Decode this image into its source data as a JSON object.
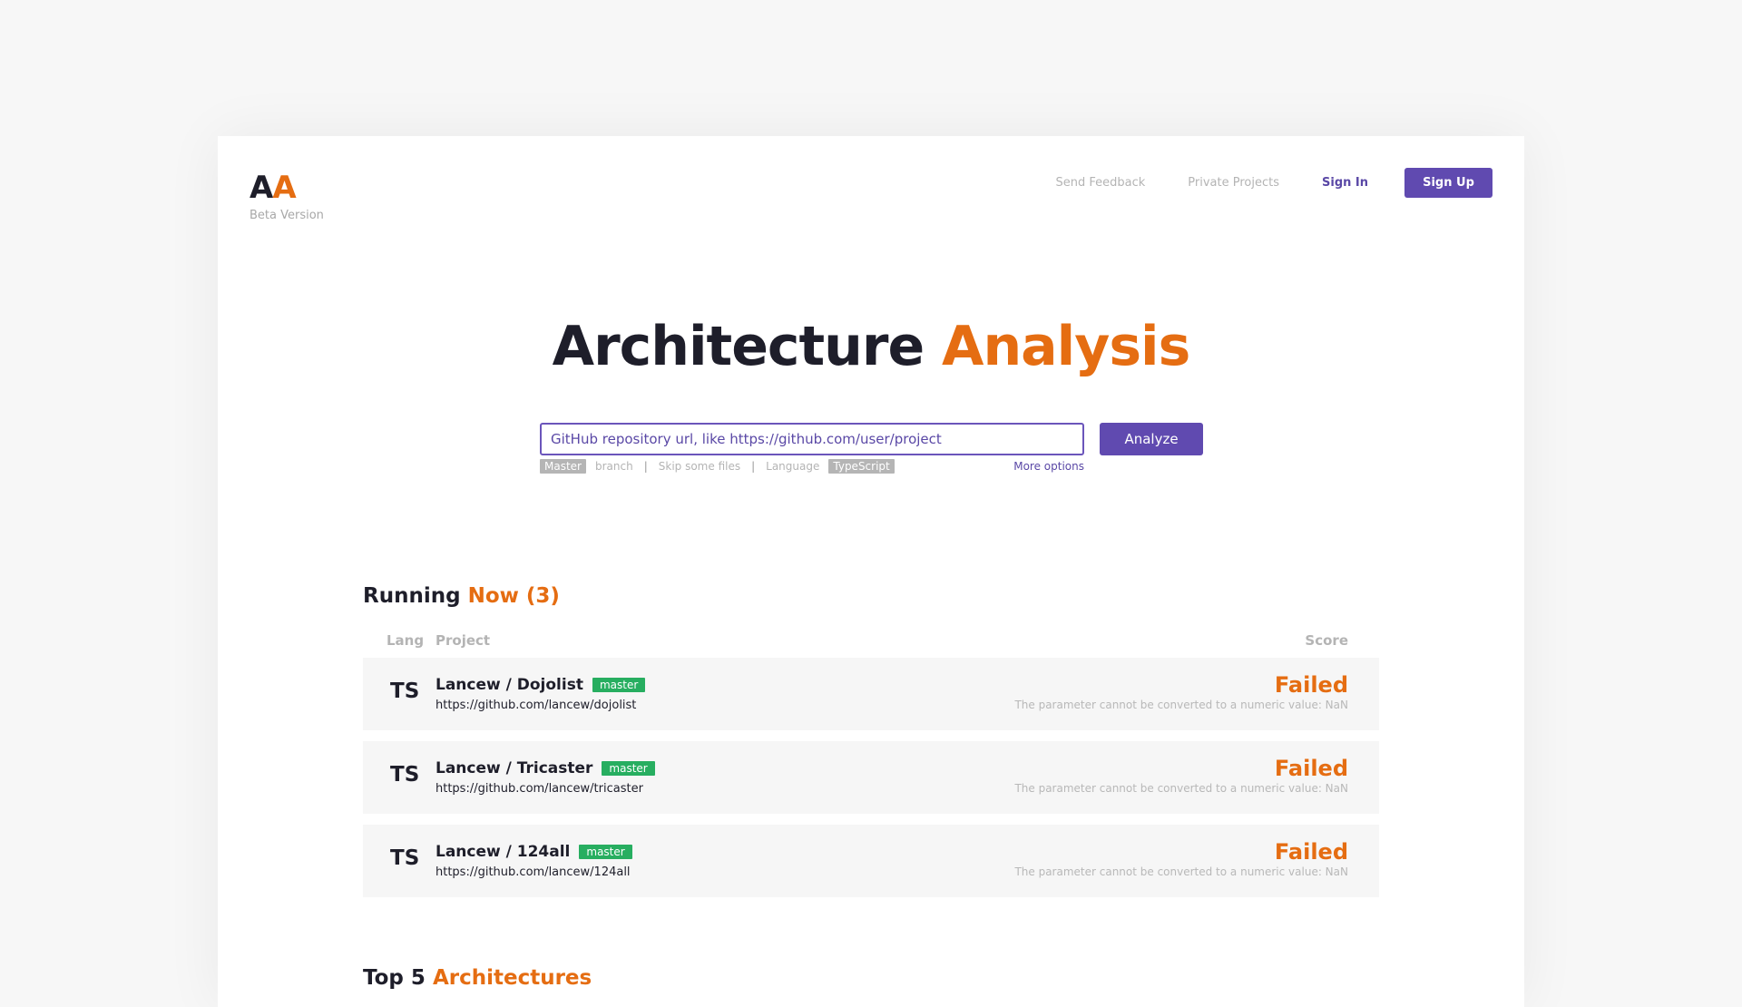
{
  "header": {
    "logo_left": "A",
    "logo_right": "A",
    "beta": "Beta Version",
    "nav": {
      "feedback": "Send Feedback",
      "private": "Private Projects",
      "signin": "Sign In",
      "signup": "Sign Up"
    }
  },
  "hero": {
    "title_part1": "Architecture",
    "title_part2": "Analysis"
  },
  "search": {
    "placeholder": "GitHub repository url, like https://github.com/user/project",
    "button": "Analyze"
  },
  "options": {
    "branch_value": "Master",
    "branch_label": "branch",
    "skip_label": "Skip some files",
    "language_label": "Language",
    "language_value": "TypeScript",
    "more": "More options",
    "separator": "|"
  },
  "running": {
    "title_part1": "Running",
    "title_part2": "Now (3)",
    "columns": {
      "lang": "Lang",
      "project": "Project",
      "score": "Score"
    },
    "rows": [
      {
        "lang": "TS",
        "name": "Lancew / Dojolist",
        "branch": "master",
        "url": "https://github.com/lancew/dojolist",
        "status": "Failed",
        "error": "The parameter cannot be converted to a numeric value: NaN"
      },
      {
        "lang": "TS",
        "name": "Lancew / Tricaster",
        "branch": "master",
        "url": "https://github.com/lancew/tricaster",
        "status": "Failed",
        "error": "The parameter cannot be converted to a numeric value: NaN"
      },
      {
        "lang": "TS",
        "name": "Lancew / 124all",
        "branch": "master",
        "url": "https://github.com/lancew/124all",
        "status": "Failed",
        "error": "The parameter cannot be converted to a numeric value: NaN"
      }
    ]
  },
  "top5": {
    "title_part1": "Top 5",
    "title_part2": "Architectures"
  }
}
